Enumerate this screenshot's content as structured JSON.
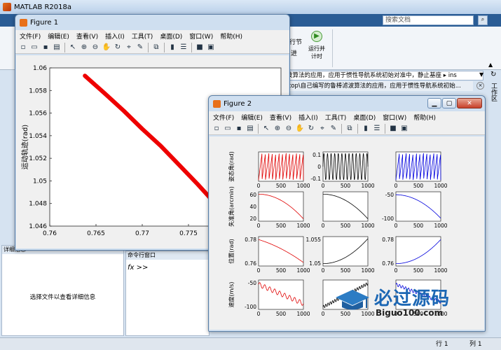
{
  "matlab": {
    "title": "MATLAB R2018a",
    "search_placeholder": "搜索文档",
    "run_section_label": "行节",
    "run_advance_label": "进",
    "run_time_label1": "运行并",
    "run_time_label2": "计时",
    "path_text": "波算法的应用，应用于惯性导航系统初始对准中，静止基座",
    "path_tail": "ins",
    "path2_text": "ktop\\自己编写的鲁棒滤波算法的应用，应用于惯性导航系统初始...",
    "workspace_vertical": "工作区",
    "details_title": "详细信息",
    "details_hint": "选择文件以查看详细信息",
    "cmd_title": "命令行窗口",
    "cmd_prompt": "fx >>",
    "status_row": "行",
    "status_col": "1",
    "status_col_label": "列",
    "status_col_val": "1"
  },
  "menus": [
    "文件(F)",
    "编辑(E)",
    "查看(V)",
    "插入(I)",
    "工具(T)",
    "桌面(D)",
    "窗口(W)",
    "帮助(H)"
  ],
  "figure1": {
    "title": "Figure 1",
    "chart_data": {
      "type": "line",
      "ylabel": "运动轨迹(rad)",
      "xlim": [
        0.76,
        0.785
      ],
      "ylim": [
        1.046,
        1.06
      ],
      "xticks": [
        "0.76",
        "0.765",
        "0.77",
        "0.775",
        "0.78"
      ],
      "yticks": [
        "1.046",
        "1.048",
        "1.05",
        "1.052",
        "1.054",
        "1.056",
        "1.058",
        "1.06"
      ],
      "x": [
        0.7638,
        0.766,
        0.768,
        0.77,
        0.772,
        0.774,
        0.776,
        0.778,
        0.78,
        0.782,
        0.7842
      ],
      "y": [
        1.0593,
        1.0577,
        1.0562,
        1.0546,
        1.0531,
        1.0514,
        1.0497,
        1.0479,
        1.0462,
        1.0447,
        1.0438
      ],
      "color": "#ee0000"
    }
  },
  "figure2": {
    "title": "Figure 2",
    "ylabels": [
      "姿态角(rad)",
      "失准角(arcmin)",
      "位置(rad)",
      "速度(m/s)"
    ],
    "xtick": [
      "0",
      "500",
      "1000"
    ],
    "colors": [
      "#e00000",
      "#000000",
      "#0000dd"
    ],
    "rows": [
      [
        {
          "yt": [
            "",
            "",
            ""
          ]
        },
        {
          "yt": [
            "0.1",
            "0",
            "-0.1"
          ]
        },
        {
          "yt": [
            "",
            "",
            ""
          ]
        }
      ],
      [
        {
          "yt": [
            "60",
            "40",
            "20"
          ]
        },
        {
          "yt": [
            "",
            "",
            ""
          ]
        },
        {
          "yt": [
            "-50",
            "-100"
          ]
        }
      ],
      [
        {
          "yt": [
            "0.78",
            "0.76"
          ]
        },
        {
          "yt": [
            "1.055",
            "1.05"
          ]
        },
        {
          "yt": [
            "0.78",
            "0.76"
          ]
        }
      ],
      [
        {
          "yt": [
            "-50",
            "-100"
          ]
        },
        {
          "yt": [
            "",
            "",
            ""
          ]
        },
        {
          "yt": [
            "",
            "",
            ""
          ]
        }
      ]
    ]
  },
  "watermark": {
    "cn": "必过源码",
    "en": "Biguo100.com"
  }
}
